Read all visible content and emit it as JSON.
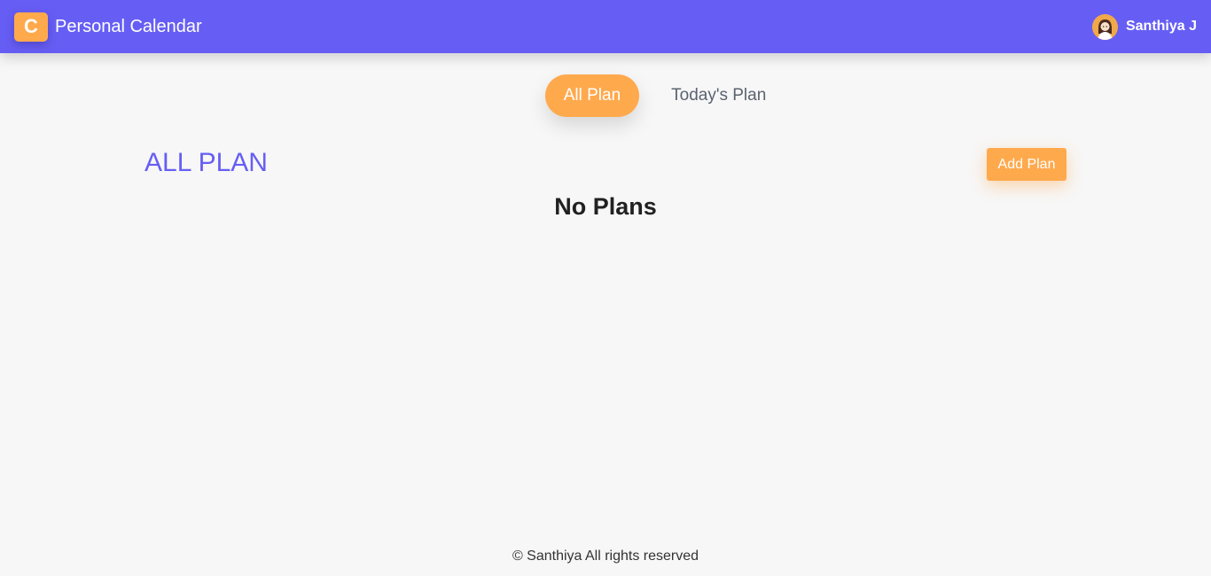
{
  "header": {
    "logo_letter": "C",
    "app_title": "Personal Calendar",
    "user_name": "Santhiya J",
    "avatar_icon": "user-avatar-icon"
  },
  "tabs": [
    {
      "label": "All Plan",
      "active": true
    },
    {
      "label": "Today's Plan",
      "active": false
    }
  ],
  "main": {
    "section_title": "ALL PLAN",
    "add_button_label": "Add Plan",
    "empty_message": "No Plans"
  },
  "footer": {
    "text": "© Santhiya All rights reserved"
  },
  "colors": {
    "primary": "#665ef4",
    "accent": "#ffa94d",
    "background": "#f7f7f7"
  }
}
